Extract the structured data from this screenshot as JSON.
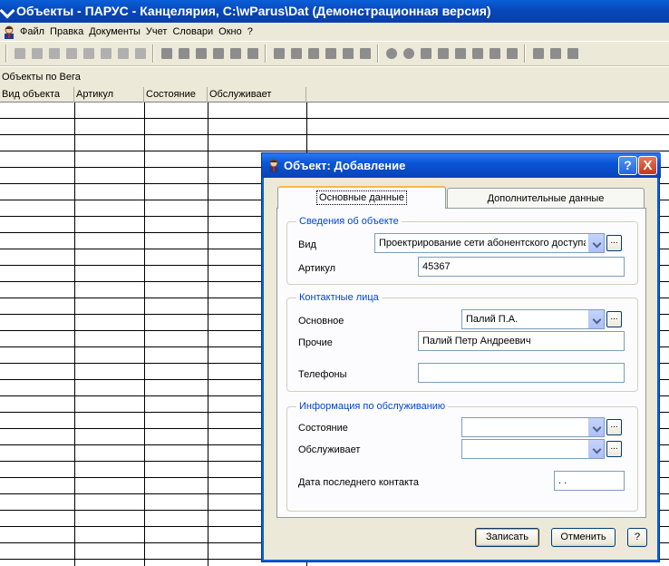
{
  "window": {
    "title": "Объекты - ПАРУС - Канцелярия, C:\\wParus\\Dat (Демонстрационная версия)"
  },
  "menu": {
    "items": [
      "Файл",
      "Правка",
      "Документы",
      "Учет",
      "Словари",
      "Окно",
      "?"
    ]
  },
  "grid": {
    "caption": "Объекты по Вега",
    "columns": [
      "Вид объекта",
      "Артикул",
      "Состояние",
      "Обслуживает"
    ]
  },
  "dialog": {
    "title": "Объект: Добавление",
    "help_button": "?",
    "close_button": "X",
    "tabs": [
      "Основные данные",
      "Дополнительные данные"
    ],
    "group_object": {
      "legend": "Сведения об объекте",
      "type_label": "Вид",
      "type_value": "Проектрирование сети абонентского доступа",
      "article_label": "Артикул",
      "article_value": "45367"
    },
    "group_contacts": {
      "legend": "Контактные лица",
      "main_label": "Основное",
      "main_value": "Палий П.А.",
      "other_label": "Прочие",
      "other_value": "Палий Петр Андреевич",
      "phones_label": "Телефоны",
      "phones_value": ""
    },
    "group_service": {
      "legend": "Информация по обслуживанию",
      "state_label": "Состояние",
      "state_value": "",
      "served_by_label": "Обслуживает",
      "served_by_value": "",
      "last_contact_label": "Дата последнего контакта",
      "last_contact_value": " .  ."
    },
    "ellipsis_label": "...",
    "buttons": {
      "save": "Записать",
      "cancel": "Отменить",
      "help": "?"
    }
  }
}
